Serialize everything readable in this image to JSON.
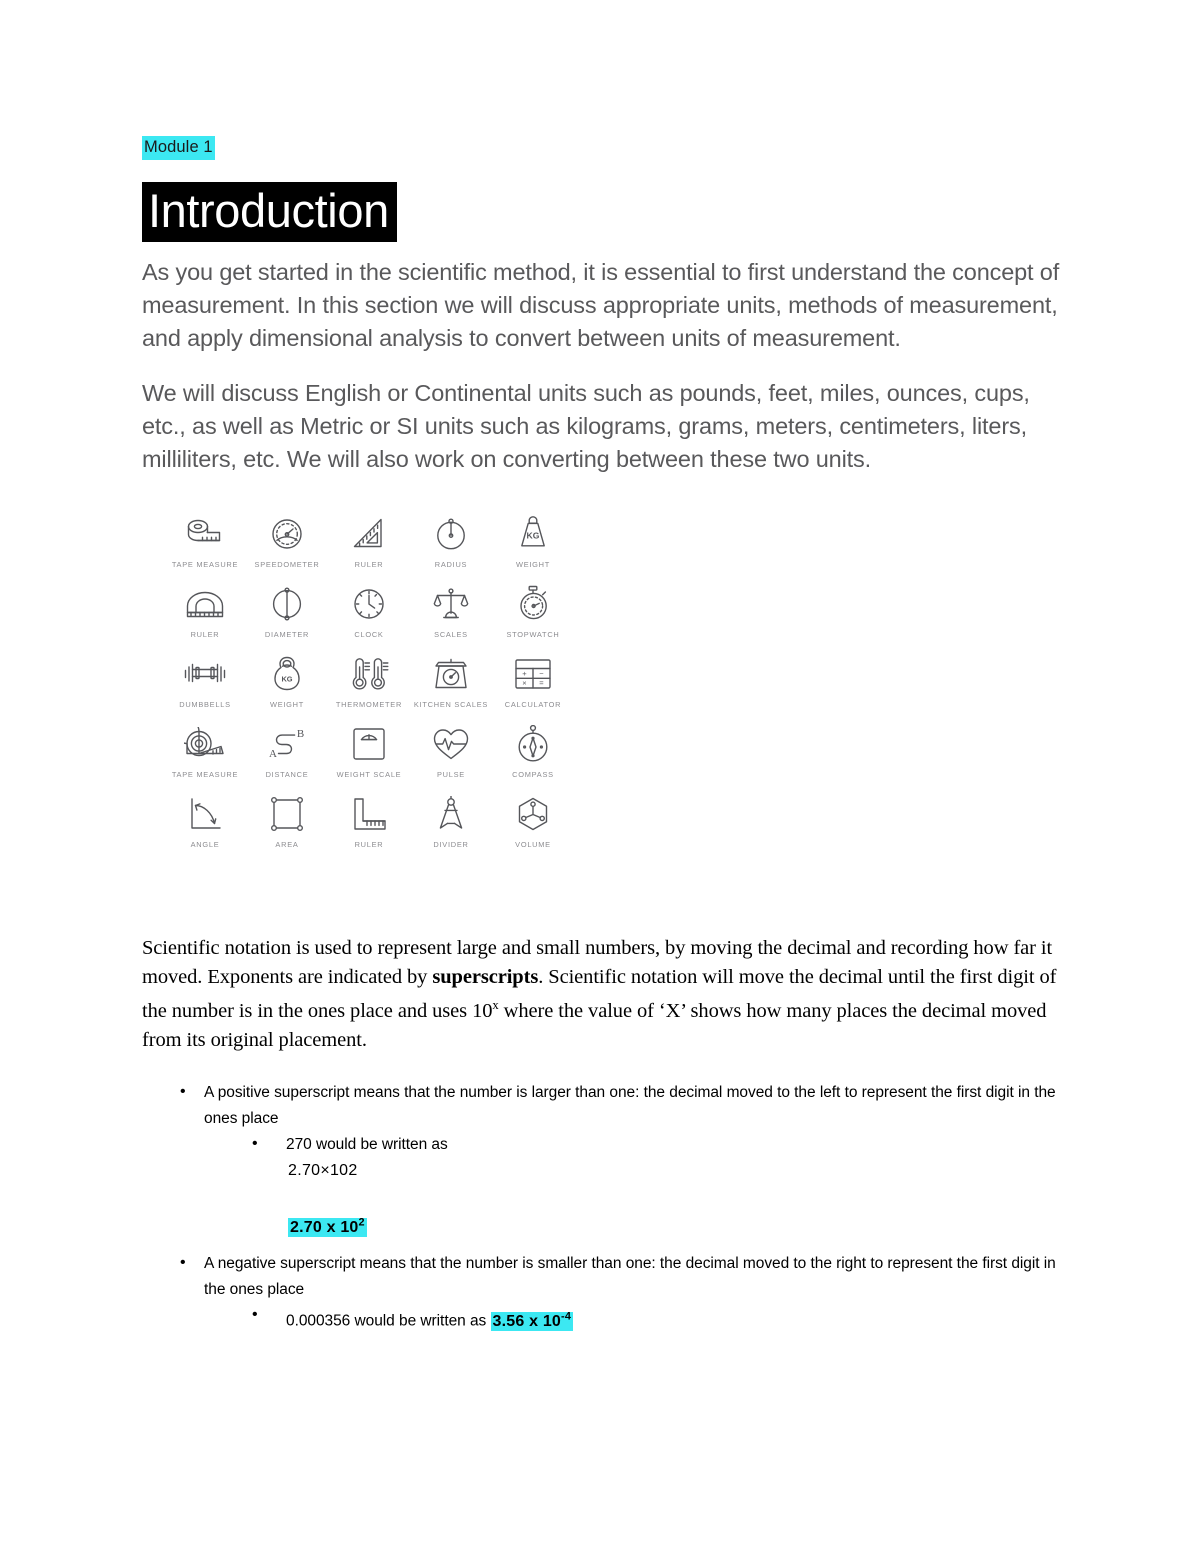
{
  "document": {
    "module_label": "Module 1",
    "heading": "Introduction",
    "intro_paragraphs": [
      "As you get started in the scientific method, it is essential to first understand the concept of measurement. In this section we will discuss appropriate units, methods of measurement, and apply dimensional analysis to convert between units of measurement.",
      "We will discuss English or Continental units such as pounds, feet, miles, ounces, cups, etc., as well as Metric or SI units such as kilograms, grams, meters, centimeters, liters, milliliters, etc. We will also work on converting between these two units."
    ],
    "scientific_notation": {
      "para_part1": "Scientific notation is used to represent large and small numbers, by moving the decimal and recording how far it moved. Exponents are indicated by ",
      "para_bold": "superscripts",
      "para_part2": ". Scientific notation will move the decimal until the first digit of the number is in the ones place and uses 10",
      "para_sup": "x",
      "para_part3": " where the value of ‘X’ shows how many places the decimal moved from its original placement.",
      "bullet_positive": "A positive superscript means that the number is larger than one: the decimal moved to the left to represent the first digit in the ones place",
      "sub_bullet_270": "270 would be written as",
      "equation_plain": "2.70×102",
      "equation_highlight_base": "2.70 x 10",
      "equation_highlight_sup": "2",
      "bullet_negative": "A negative superscript means that the number is smaller than one: the decimal moved to the right to represent the first digit in the ones place",
      "sub_bullet_negative_prefix": "0.000356 would be written as ",
      "sub_bullet_negative_highlight_base": "3.56 x 10",
      "sub_bullet_negative_highlight_sup": "-4"
    },
    "icon_grid": {
      "rows": [
        [
          {
            "icon": "tape-measure-icon",
            "caption": "TAPE MEASURE"
          },
          {
            "icon": "speedometer-icon",
            "caption": "SPEEDOMETER"
          },
          {
            "icon": "ruler-triangle-icon",
            "caption": "RULER"
          },
          {
            "icon": "radius-circle-icon",
            "caption": "RADIUS"
          },
          {
            "icon": "weight-kg-icon",
            "caption": "WEIGHT"
          }
        ],
        [
          {
            "icon": "protractor-ruler-icon",
            "caption": "RULER"
          },
          {
            "icon": "diameter-circle-icon",
            "caption": "DIAMETER"
          },
          {
            "icon": "clock-icon",
            "caption": "CLOCK"
          },
          {
            "icon": "balance-scales-icon",
            "caption": "SCALES"
          },
          {
            "icon": "stopwatch-icon",
            "caption": "STOPWATCH"
          }
        ],
        [
          {
            "icon": "dumbbells-icon",
            "caption": "DUMBBELLS"
          },
          {
            "icon": "kettlebell-weight-icon",
            "caption": "WEIGHT"
          },
          {
            "icon": "thermometer-icon",
            "caption": "THERMOMETER"
          },
          {
            "icon": "kitchen-scales-icon",
            "caption": "KITCHEN SCALES"
          },
          {
            "icon": "calculator-icon",
            "caption": "CALCULATOR"
          }
        ],
        [
          {
            "icon": "tape-measure-reel-icon",
            "caption": "TAPE MEASURE"
          },
          {
            "icon": "distance-ab-icon",
            "caption": "DISTANCE"
          },
          {
            "icon": "weight-scale-icon",
            "caption": "WEIGHT SCALE"
          },
          {
            "icon": "pulse-heart-icon",
            "caption": "PULSE"
          },
          {
            "icon": "compass-icon",
            "caption": "COMPASS"
          }
        ],
        [
          {
            "icon": "angle-icon",
            "caption": "ANGLE"
          },
          {
            "icon": "area-square-icon",
            "caption": "AREA"
          },
          {
            "icon": "ruler-lshape-icon",
            "caption": "RULER"
          },
          {
            "icon": "divider-compass-icon",
            "caption": "DIVIDER"
          },
          {
            "icon": "volume-hexagon-icon",
            "caption": "VOLUME"
          }
        ]
      ]
    },
    "colors": {
      "highlight": "#3ce8f2",
      "heading_background": "#000000",
      "heading_text": "#ffffff",
      "body_text": "#59595b",
      "icon_stroke": "#55565a",
      "icon_caption": "#8c8c90"
    }
  }
}
